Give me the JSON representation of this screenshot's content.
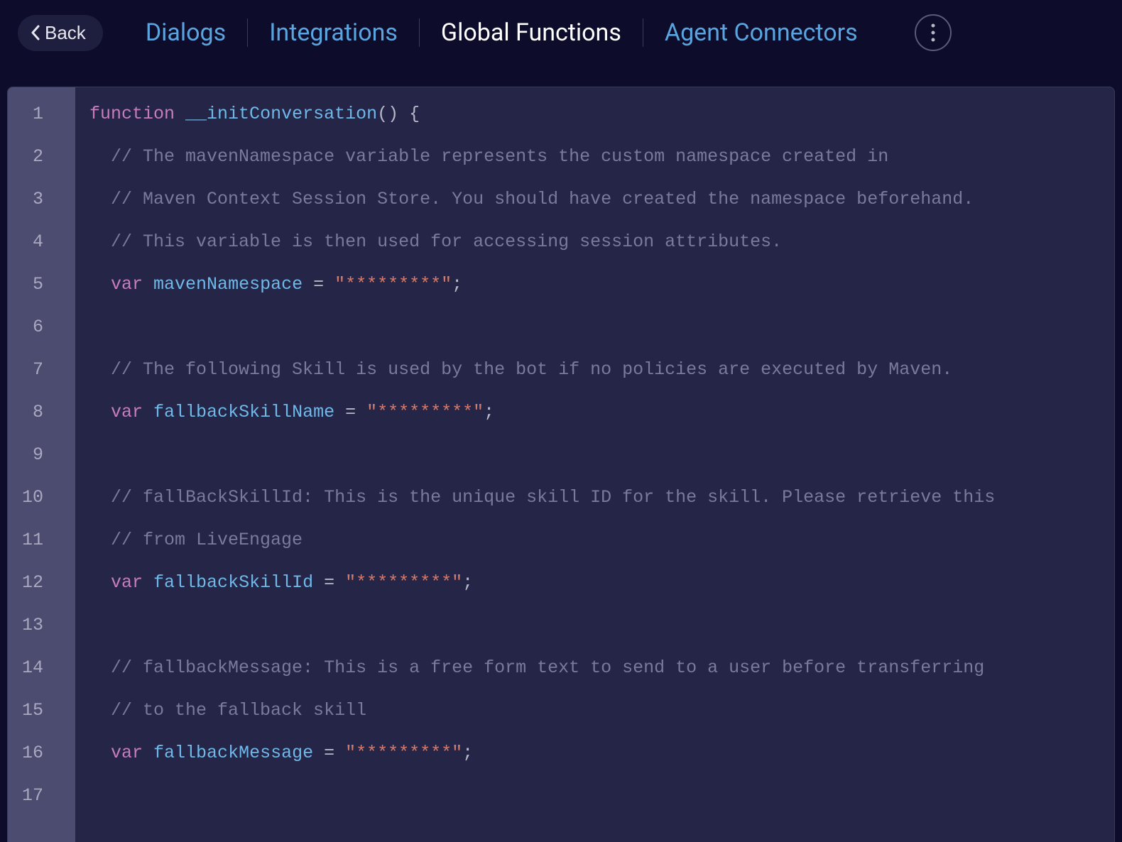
{
  "header": {
    "back_label": "Back",
    "tabs": {
      "dialogs": "Dialogs",
      "integrations": "Integrations",
      "global_functions": "Global Functions",
      "agent_connectors": "Agent Connectors"
    }
  },
  "editor": {
    "lines": [
      {
        "n": "1",
        "type": "code",
        "tokens": [
          {
            "t": "kw",
            "v": "function"
          },
          {
            "t": "sp",
            "v": " "
          },
          {
            "t": "fn",
            "v": "__initConversation"
          },
          {
            "t": "paren",
            "v": "()"
          },
          {
            "t": "sp",
            "v": " "
          },
          {
            "t": "brace",
            "v": "{"
          }
        ]
      },
      {
        "n": "2",
        "type": "comment",
        "indent": "  ",
        "text": "// The mavenNamespace variable represents the custom namespace created in"
      },
      {
        "n": "3",
        "type": "comment",
        "indent": "  ",
        "text": "// Maven Context Session Store. You should have created the namespace beforehand."
      },
      {
        "n": "4",
        "type": "comment",
        "indent": "  ",
        "text": "// This variable is then used for accessing session attributes."
      },
      {
        "n": "5",
        "type": "vardecl",
        "indent": "  ",
        "name": "mavenNamespace",
        "value": "\"*********\""
      },
      {
        "n": "6",
        "type": "blank"
      },
      {
        "n": "7",
        "type": "comment",
        "indent": "  ",
        "text": "// The following Skill is used by the bot if no policies are executed by Maven."
      },
      {
        "n": "8",
        "type": "vardecl",
        "indent": "  ",
        "name": "fallbackSkillName",
        "value": "\"*********\""
      },
      {
        "n": "9",
        "type": "blank"
      },
      {
        "n": "10",
        "type": "comment",
        "indent": "  ",
        "text": "// fallBackSkillId: This is the unique skill ID for the skill. Please retrieve this"
      },
      {
        "n": "11",
        "type": "comment",
        "indent": "  ",
        "text": "// from LiveEngage"
      },
      {
        "n": "12",
        "type": "vardecl",
        "indent": "  ",
        "name": "fallbackSkillId",
        "value": "\"*********\""
      },
      {
        "n": "13",
        "type": "blank"
      },
      {
        "n": "14",
        "type": "comment",
        "indent": "  ",
        "text": "// fallbackMessage: This is a free form text to send to a user before transferring"
      },
      {
        "n": "15",
        "type": "comment",
        "indent": "  ",
        "text": "// to the fallback skill"
      },
      {
        "n": "16",
        "type": "vardecl",
        "indent": "  ",
        "name": "fallbackMessage",
        "value": "\"*********\""
      },
      {
        "n": "17",
        "type": "blank"
      }
    ]
  }
}
